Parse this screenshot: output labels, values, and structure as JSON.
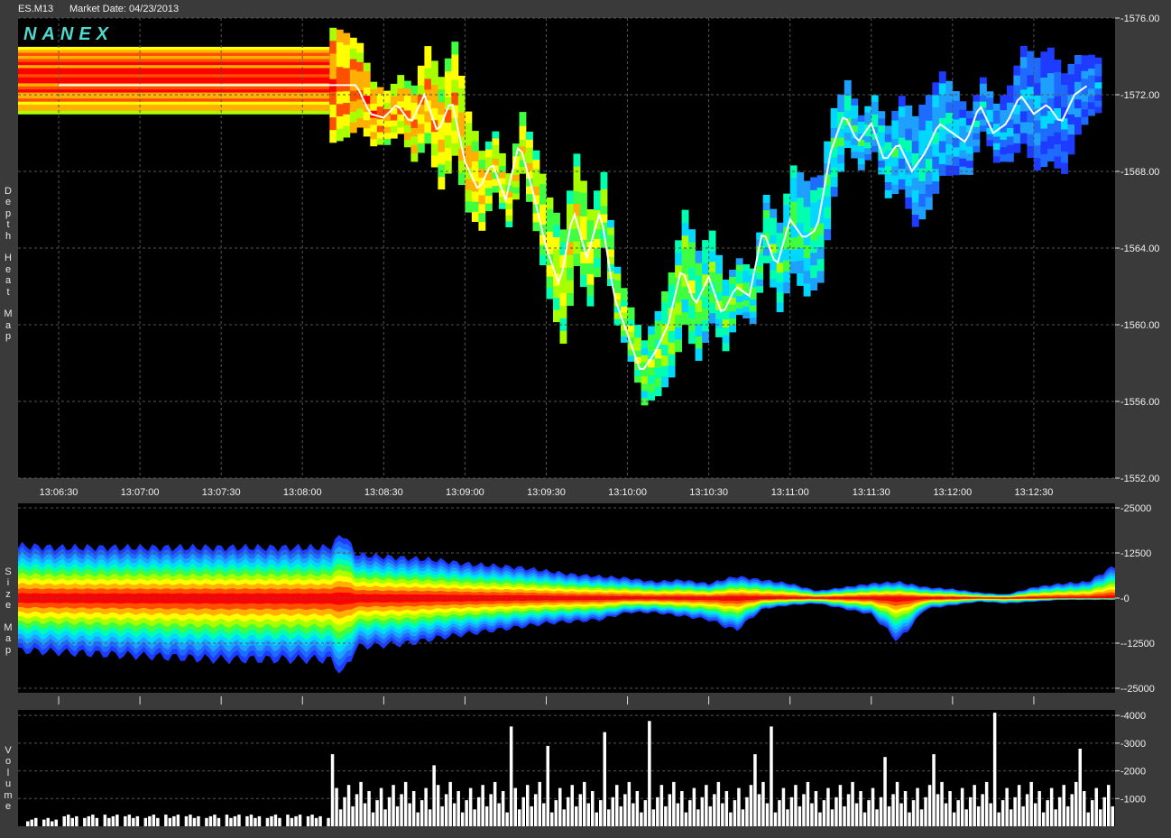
{
  "header": {
    "symbol": "ES.M13",
    "market_date": "Market Date: 04/23/2013"
  },
  "panels": {
    "depth_label": "Depth Heat Map",
    "size_label": "Size Map",
    "volume_label": "Volume",
    "logo": "NANEX"
  },
  "colors": {
    "background": "#000000",
    "frame": "#3a3a3a",
    "grid": "#555555",
    "price_line": "#ffffff",
    "volume_bars": "#ffffff",
    "heat_scale": [
      "#1e3cff",
      "#1e6cff",
      "#1ea0ff",
      "#00d8ff",
      "#00ffb0",
      "#40ff40",
      "#a8ff00",
      "#ffff00",
      "#ffb000",
      "#ff5000",
      "#ff0000"
    ]
  },
  "chart_data": [
    {
      "type": "heatmap",
      "name": "depth-heat-map",
      "x_ticks": [
        "13:06:30",
        "13:07:00",
        "13:07:30",
        "13:08:00",
        "13:08:30",
        "13:09:00",
        "13:09:30",
        "13:10:00",
        "13:10:30",
        "13:11:00",
        "13:11:30",
        "13:12:00",
        "13:12:30"
      ],
      "y_ticks": [
        "1576.00",
        "1572.00",
        "1568.00",
        "1564.00",
        "1560.00",
        "1556.00",
        "1552.00"
      ],
      "ylim": [
        1552,
        1576
      ],
      "x_range_seconds": [
        -15,
        390
      ],
      "price_series": {
        "t": [
          0,
          30,
          60,
          90,
          100,
          110,
          115,
          120,
          125,
          130,
          135,
          140,
          145,
          150,
          155,
          160,
          165,
          170,
          175,
          180,
          185,
          190,
          195,
          200,
          205,
          210,
          215,
          220,
          225,
          230,
          235,
          240,
          245,
          250,
          255,
          260,
          265,
          270,
          275,
          280,
          285,
          290,
          295,
          300,
          305,
          310,
          315,
          320,
          325,
          330,
          335,
          340,
          345,
          350,
          355,
          360,
          365,
          370,
          375,
          380
        ],
        "price": [
          1572.5,
          1572.5,
          1572.5,
          1572.5,
          1572.5,
          1572.5,
          1571.0,
          1570.8,
          1571.5,
          1570.5,
          1572.0,
          1570.0,
          1571.8,
          1568.5,
          1567.0,
          1568.5,
          1566.5,
          1569.5,
          1567.0,
          1564.0,
          1562.0,
          1566.0,
          1563.5,
          1566.0,
          1561.5,
          1559.5,
          1557.5,
          1558.5,
          1560.0,
          1563.0,
          1561.0,
          1562.5,
          1560.5,
          1562.0,
          1561.5,
          1565.0,
          1563.0,
          1565.5,
          1564.5,
          1565.0,
          1569.0,
          1571.0,
          1569.5,
          1570.5,
          1568.5,
          1569.5,
          1568.0,
          1569.0,
          1570.5,
          1570.0,
          1569.5,
          1571.5,
          1570.0,
          1570.5,
          1572.0,
          1571.0,
          1571.5,
          1570.5,
          1572.0,
          1572.5
        ]
      }
    },
    {
      "type": "area",
      "name": "size-map",
      "y_ticks": [
        "25000",
        "12500",
        "0",
        "-12500",
        "-25000"
      ],
      "ylim": [
        -25000,
        25000
      ],
      "envelope": {
        "t": [
          -15,
          0,
          30,
          60,
          90,
          100,
          105,
          110,
          120,
          130,
          140,
          150,
          160,
          170,
          180,
          190,
          200,
          210,
          220,
          230,
          240,
          250,
          260,
          270,
          280,
          290,
          300,
          310,
          320,
          330,
          340,
          350,
          360,
          370,
          380,
          390
        ],
        "upper": [
          14500,
          14000,
          14000,
          14000,
          14000,
          14000,
          18000,
          12000,
          11500,
          11000,
          10500,
          9500,
          9000,
          8500,
          7500,
          6500,
          6000,
          5500,
          4500,
          5000,
          4000,
          6000,
          5000,
          4000,
          2000,
          3000,
          4000,
          4500,
          3000,
          2500,
          1500,
          1000,
          3000,
          4000,
          4500,
          9000
        ],
        "lower": [
          -14500,
          -15000,
          -16000,
          -17000,
          -17000,
          -17000,
          -21000,
          -13500,
          -13000,
          -12500,
          -11000,
          -10000,
          -9000,
          -8000,
          -7000,
          -6500,
          -6000,
          -4000,
          -4000,
          -5000,
          -6000,
          -9000,
          -3000,
          -2000,
          -1500,
          -3000,
          -4500,
          -12000,
          -3000,
          -2000,
          -1000,
          -1500,
          -1000,
          -500,
          -500,
          -500
        ]
      }
    },
    {
      "type": "bar",
      "name": "volume",
      "y_ticks": [
        "4000",
        "3000",
        "2000",
        "1000"
      ],
      "ylim": [
        0,
        4200
      ],
      "buckets_seconds": 1.5,
      "level_before_open": 300,
      "open_time": 100,
      "spikes": [
        {
          "t": 101,
          "v": 2600
        },
        {
          "t": 138,
          "v": 2200
        },
        {
          "t": 167,
          "v": 3600
        },
        {
          "t": 180,
          "v": 2900
        },
        {
          "t": 201,
          "v": 3400
        },
        {
          "t": 218,
          "v": 3800
        },
        {
          "t": 256,
          "v": 2600
        },
        {
          "t": 263,
          "v": 3600
        },
        {
          "t": 305,
          "v": 2500
        },
        {
          "t": 323,
          "v": 2600
        },
        {
          "t": 345,
          "v": 4100
        },
        {
          "t": 377,
          "v": 2800
        }
      ]
    }
  ]
}
